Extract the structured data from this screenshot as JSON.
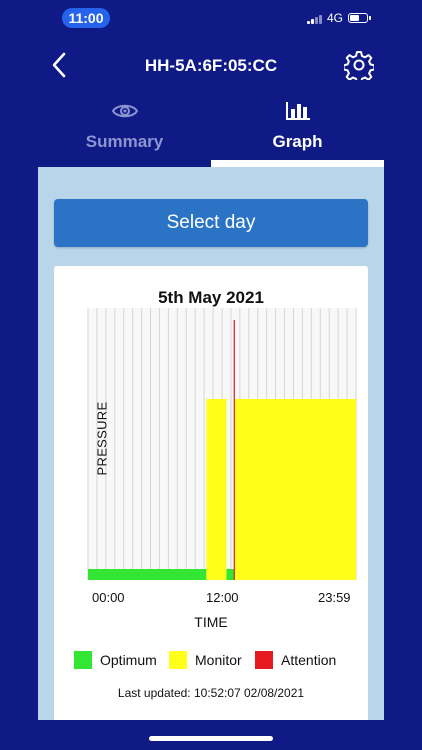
{
  "status_bar": {
    "time": "11:00",
    "network": "4G"
  },
  "header": {
    "title": "HH-5A:6F:05:CC",
    "back_icon": "chevron-left-icon",
    "settings_icon": "gear-icon"
  },
  "tabs": [
    {
      "label": "Summary",
      "icon": "eye-icon",
      "active": false
    },
    {
      "label": "Graph",
      "icon": "bar-chart-icon",
      "active": true
    }
  ],
  "select_day": {
    "label": "Select day"
  },
  "colors": {
    "optimum": "#33e633",
    "monitor": "#ffff1a",
    "attention": "#e6191e",
    "primary": "#0f1a86",
    "button": "#2b74c5"
  },
  "chart_data": {
    "type": "area",
    "title": "5th May 2021",
    "ylabel": "PRESSURE",
    "xlabel": "TIME",
    "x_ticks": [
      "00:00",
      "12:00",
      "23:59"
    ],
    "x_range_hours": [
      0,
      24
    ],
    "levels": [
      "Optimum",
      "Monitor",
      "Attention"
    ],
    "segments": [
      {
        "level": "Optimum",
        "start_hour": 0.0,
        "end_hour": 10.6
      },
      {
        "level": "Monitor",
        "start_hour": 10.6,
        "end_hour": 12.4
      },
      {
        "level": "Optimum",
        "start_hour": 12.4,
        "end_hour": 13.1
      },
      {
        "level": "Monitor",
        "start_hour": 13.1,
        "end_hour": 24.0
      }
    ],
    "markers": [
      {
        "level": "Attention",
        "hour": 13.1
      }
    ],
    "vertical_grid_lines": 30
  },
  "legend": [
    {
      "label": "Optimum",
      "color": "#33e633"
    },
    {
      "label": "Monitor",
      "color": "#ffff1a"
    },
    {
      "label": "Attention",
      "color": "#e6191e"
    }
  ],
  "footer": {
    "last_updated": "Last updated: 10:52:07 02/08/2021"
  }
}
